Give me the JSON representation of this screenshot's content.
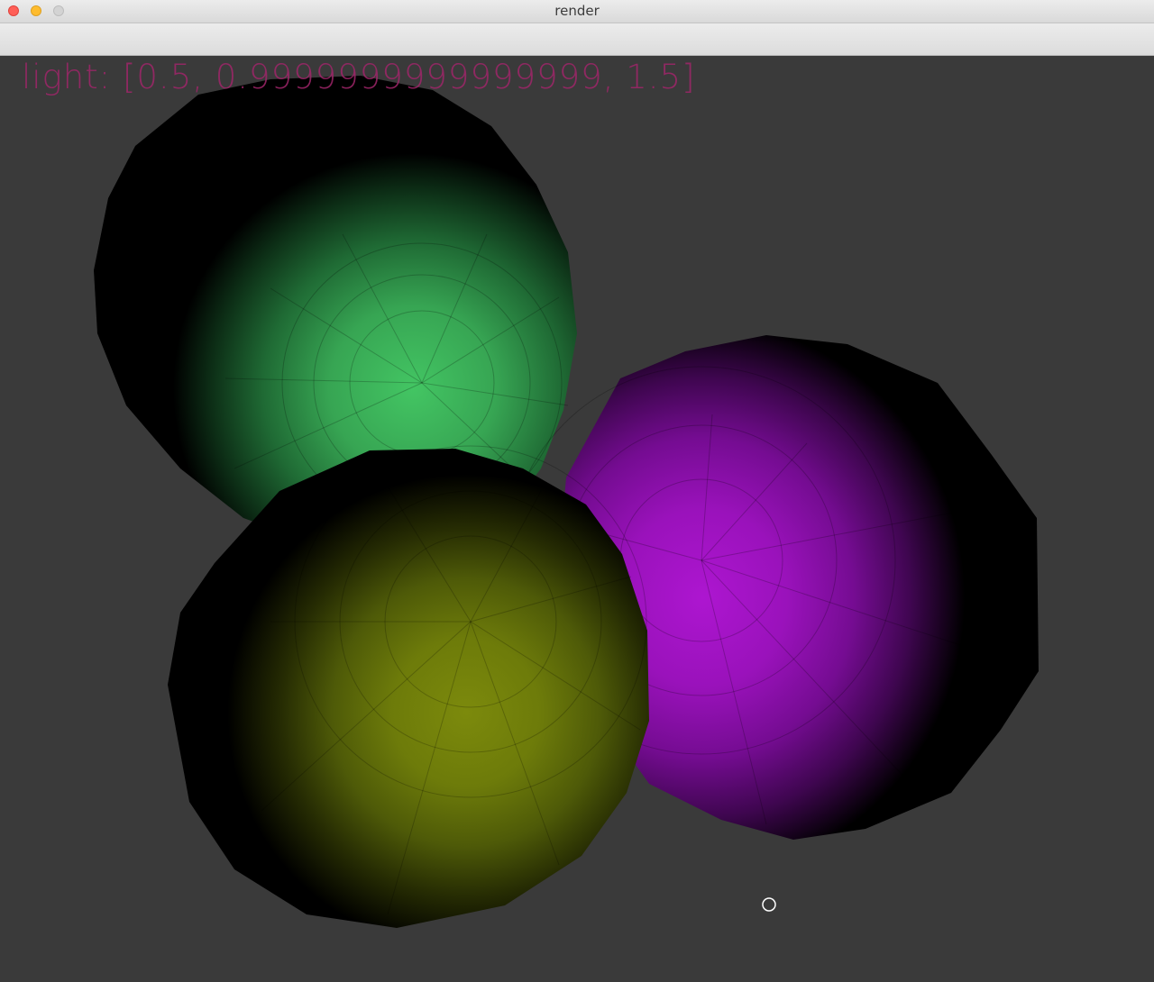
{
  "window": {
    "title": "render"
  },
  "overlay": {
    "label": "light: ",
    "value": "[0.5, 0.9999999999999999, 1.5]",
    "color": "#a0266a"
  },
  "scene": {
    "background_color": "#3a3a3a",
    "spheres": [
      {
        "name": "green-sphere",
        "base_color": "#3cc25a"
      },
      {
        "name": "magenta-sphere",
        "base_color": "#b312d2"
      },
      {
        "name": "yellow-sphere",
        "base_color": "#8a9a0c"
      }
    ]
  },
  "cursor": {
    "icon": "circle-cursor-icon"
  }
}
